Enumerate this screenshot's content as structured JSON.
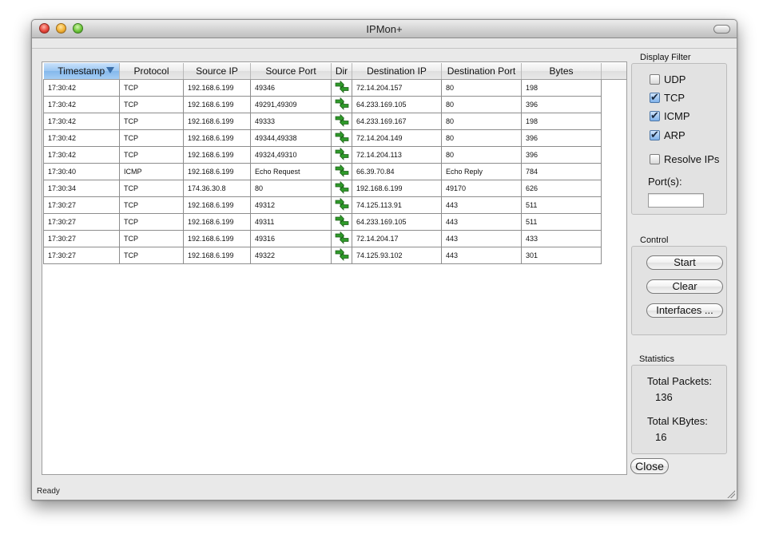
{
  "window": {
    "title": "IPMon+"
  },
  "table": {
    "columns": [
      "Timestamp",
      "Protocol",
      "Source IP",
      "Source Port",
      "Dir",
      "Destination IP",
      "Destination Port",
      "Bytes"
    ],
    "sorted_column": "Timestamp",
    "dir_icon": "bidirectional-arrows-icon",
    "rows": [
      {
        "ts": "17:30:42",
        "proto": "TCP",
        "src": "192.168.6.199",
        "sport": "49346",
        "dst": "72.14.204.157",
        "dport": "80",
        "bytes": "198"
      },
      {
        "ts": "17:30:42",
        "proto": "TCP",
        "src": "192.168.6.199",
        "sport": "49291,49309",
        "dst": "64.233.169.105",
        "dport": "80",
        "bytes": "396"
      },
      {
        "ts": "17:30:42",
        "proto": "TCP",
        "src": "192.168.6.199",
        "sport": "49333",
        "dst": "64.233.169.167",
        "dport": "80",
        "bytes": "198"
      },
      {
        "ts": "17:30:42",
        "proto": "TCP",
        "src": "192.168.6.199",
        "sport": "49344,49338",
        "dst": "72.14.204.149",
        "dport": "80",
        "bytes": "396"
      },
      {
        "ts": "17:30:42",
        "proto": "TCP",
        "src": "192.168.6.199",
        "sport": "49324,49310",
        "dst": "72.14.204.113",
        "dport": "80",
        "bytes": "396"
      },
      {
        "ts": "17:30:40",
        "proto": "ICMP",
        "src": "192.168.6.199",
        "sport": "Echo Request",
        "dst": "66.39.70.84",
        "dport": "Echo Reply",
        "bytes": "784"
      },
      {
        "ts": "17:30:34",
        "proto": "TCP",
        "src": "174.36.30.8",
        "sport": "80",
        "dst": "192.168.6.199",
        "dport": "49170",
        "bytes": "626"
      },
      {
        "ts": "17:30:27",
        "proto": "TCP",
        "src": "192.168.6.199",
        "sport": "49312",
        "dst": "74.125.113.91",
        "dport": "443",
        "bytes": "511"
      },
      {
        "ts": "17:30:27",
        "proto": "TCP",
        "src": "192.168.6.199",
        "sport": "49311",
        "dst": "64.233.169.105",
        "dport": "443",
        "bytes": "511"
      },
      {
        "ts": "17:30:27",
        "proto": "TCP",
        "src": "192.168.6.199",
        "sport": "49316",
        "dst": "72.14.204.17",
        "dport": "443",
        "bytes": "433"
      },
      {
        "ts": "17:30:27",
        "proto": "TCP",
        "src": "192.168.6.199",
        "sport": "49322",
        "dst": "74.125.93.102",
        "dport": "443",
        "bytes": "301"
      }
    ]
  },
  "display_filter": {
    "label": "Display Filter",
    "udp": {
      "label": "UDP",
      "checked": false
    },
    "tcp": {
      "label": "TCP",
      "checked": true
    },
    "icmp": {
      "label": "ICMP",
      "checked": true
    },
    "arp": {
      "label": "ARP",
      "checked": true
    },
    "resolve_ips": {
      "label": "Resolve IPs",
      "checked": false
    },
    "ports_label": "Port(s):",
    "ports_value": ""
  },
  "control": {
    "label": "Control",
    "start": "Start",
    "clear": "Clear",
    "interfaces": "Interfaces ..."
  },
  "statistics": {
    "label": "Statistics",
    "total_packets_label": "Total Packets:",
    "total_packets": "136",
    "total_kbytes_label": "Total KBytes:",
    "total_kbytes": "16"
  },
  "close_label": "Close",
  "status_text": "Ready",
  "colors": {
    "dir_arrow": "#2f9a2a",
    "sorted_header": "#9cc7f2"
  }
}
